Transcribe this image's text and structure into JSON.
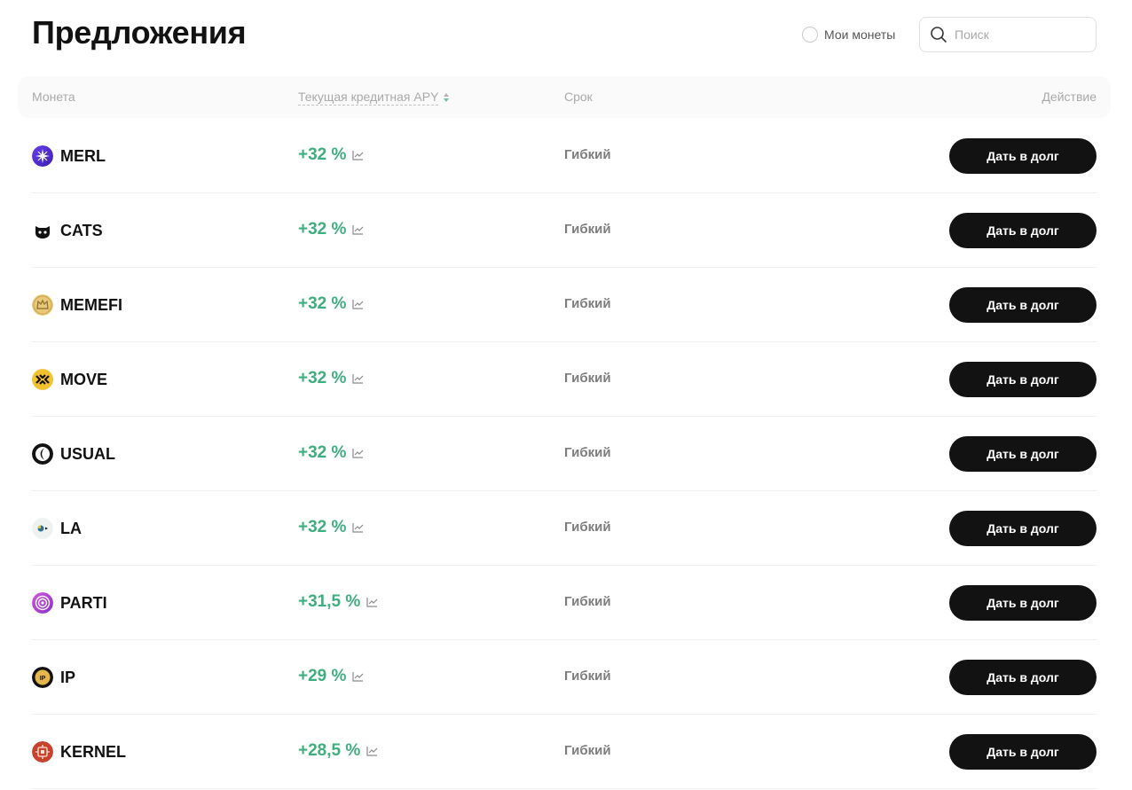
{
  "header": {
    "title": "Предложения",
    "my_coins_label": "Мои монеты",
    "my_coins_checked": false,
    "search_placeholder": "Поиск"
  },
  "table": {
    "columns": {
      "coin": "Монета",
      "apy": "Текущая кредитная APY",
      "term": "Срок",
      "action": "Действие"
    },
    "rows": [
      {
        "coin": "MERL",
        "apy": "+32 %",
        "term": "Гибкий",
        "action": "Дать в долг",
        "icon": "merl-icon"
      },
      {
        "coin": "CATS",
        "apy": "+32 %",
        "term": "Гибкий",
        "action": "Дать в долг",
        "icon": "cats-icon"
      },
      {
        "coin": "MEMEFI",
        "apy": "+32 %",
        "term": "Гибкий",
        "action": "Дать в долг",
        "icon": "memefi-icon"
      },
      {
        "coin": "MOVE",
        "apy": "+32 %",
        "term": "Гибкий",
        "action": "Дать в долг",
        "icon": "move-icon"
      },
      {
        "coin": "USUAL",
        "apy": "+32 %",
        "term": "Гибкий",
        "action": "Дать в долг",
        "icon": "usual-icon"
      },
      {
        "coin": "LA",
        "apy": "+32 %",
        "term": "Гибкий",
        "action": "Дать в долг",
        "icon": "la-icon"
      },
      {
        "coin": "PARTI",
        "apy": "+31,5 %",
        "term": "Гибкий",
        "action": "Дать в долг",
        "icon": "parti-icon"
      },
      {
        "coin": "IP",
        "apy": "+29 %",
        "term": "Гибкий",
        "action": "Дать в долг",
        "icon": "ip-icon",
        "icon_text": "IP"
      },
      {
        "coin": "KERNEL",
        "apy": "+28,5 %",
        "term": "Гибкий",
        "action": "Дать в долг",
        "icon": "kernel-icon"
      }
    ]
  },
  "colors": {
    "apy_positive": "#3fae7e",
    "button_bg": "#121212",
    "button_text": "#ffffff",
    "header_bg": "#fafafa"
  }
}
